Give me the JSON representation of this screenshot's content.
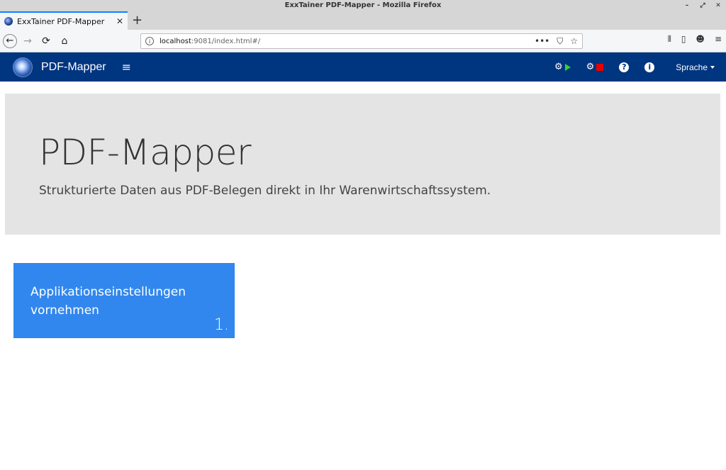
{
  "window": {
    "title": "ExxTainer PDF-Mapper - Mozilla Firefox",
    "controls": [
      "–",
      "⤢",
      "✕"
    ]
  },
  "browser": {
    "tab_title": "ExxTainer PDF-Mapper",
    "tab_close": "✕",
    "new_tab": "+",
    "url_host": "localhost",
    "url_path": ":9081/index.html#/",
    "nav_back": "←",
    "nav_forward": "→",
    "nav_reload": "⟳",
    "nav_home": "⌂",
    "url_more": "•••",
    "url_pocket": "⛉",
    "url_bookmark": "☆",
    "toolbar_library": "⫴",
    "toolbar_sidebar": "▯",
    "toolbar_account": "☻",
    "toolbar_menu": "≡",
    "icons": [
      "info-icon",
      "back-icon",
      "forward-icon",
      "reload-icon",
      "home-icon",
      "more-icon",
      "pocket-icon",
      "bookmark-icon",
      "library-icon",
      "sidebar-icon",
      "account-icon",
      "menu-icon"
    ]
  },
  "app": {
    "brand": "PDF-Mapper",
    "menu_glyph": "≡",
    "start_glyph": "⚙",
    "stop_glyph": "⚙",
    "help_glyph": "?",
    "info_glyph": "i",
    "language_label": "Sprache",
    "colors": {
      "navbar": "#003580",
      "start": "#36d136",
      "stop": "#e60000",
      "tile": "#3187ed",
      "jumbotron": "#e4e4e4"
    }
  },
  "jumbotron": {
    "title": "PDF-Mapper",
    "subtitle": "Strukturierte Daten aus PDF-Belegen direkt in Ihr Warenwirtschaftssystem."
  },
  "tiles": [
    {
      "label": "Applikationseinstellungen vornehmen",
      "number": "1."
    }
  ]
}
